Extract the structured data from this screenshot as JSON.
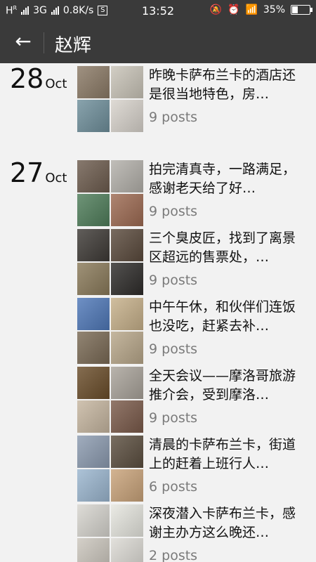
{
  "status_bar": {
    "carrier_left": "H",
    "carrier_left_sup": "R",
    "net": "3G",
    "speed": "0.8K/s",
    "s_badge": "S",
    "time": "13:52",
    "battery": "35%",
    "battery_level": 0.35
  },
  "app_bar": {
    "back_icon": "arrow-left-icon",
    "title": "赵辉"
  },
  "groups": [
    {
      "day": "28",
      "month": "Oct",
      "posts": [
        {
          "text": "昨晚卡萨布兰卡的酒店还是很当地特色，房…",
          "count": "9 posts",
          "thumbs": [
            "#8b7a66",
            "#c9c4b8",
            "#6f8f9b",
            "#d8d3cc"
          ]
        }
      ]
    },
    {
      "day": "27",
      "month": "Oct",
      "posts": [
        {
          "text": "拍完清真寺，一路满足，感谢老天给了好…",
          "count": "9 posts",
          "thumbs": [
            "#6d5c4e",
            "#b3b0aa",
            "#4f7d5a",
            "#9d6a52"
          ]
        },
        {
          "text": "三个臭皮匠，找到了离景区超远的售票处，…",
          "count": "9 posts",
          "thumbs": [
            "#3e3a36",
            "#5a4a3c",
            "#8a7a5a",
            "#2e2c2a"
          ]
        },
        {
          "text": "中午午休，和伙伴们连饭也没吃，赶紧去补…",
          "count": "9 posts",
          "thumbs": [
            "#4f78b8",
            "#c6b08a",
            "#7a6a55",
            "#b8a78a"
          ]
        },
        {
          "text": "全天会议——摩洛哥旅游推介会，受到摩洛…",
          "count": "9 posts",
          "thumbs": [
            "#6a4d2a",
            "#a9a39a",
            "#c6b6a0",
            "#7a5a4a"
          ]
        },
        {
          "text": "清晨的卡萨布兰卡，街道上的赶着上班行人…",
          "count": "6 posts",
          "thumbs": [
            "#8c9bb0",
            "#5b4e3f",
            "#9bb6cf",
            "#c9a37a"
          ]
        },
        {
          "text": "深夜潜入卡萨布兰卡，感谢主办方这么晚还…",
          "count": "2 posts",
          "thumbs": [
            "#d7d5cf",
            "#e6e6df",
            "#cbc6bd",
            "#dcdad4"
          ]
        }
      ]
    }
  ]
}
